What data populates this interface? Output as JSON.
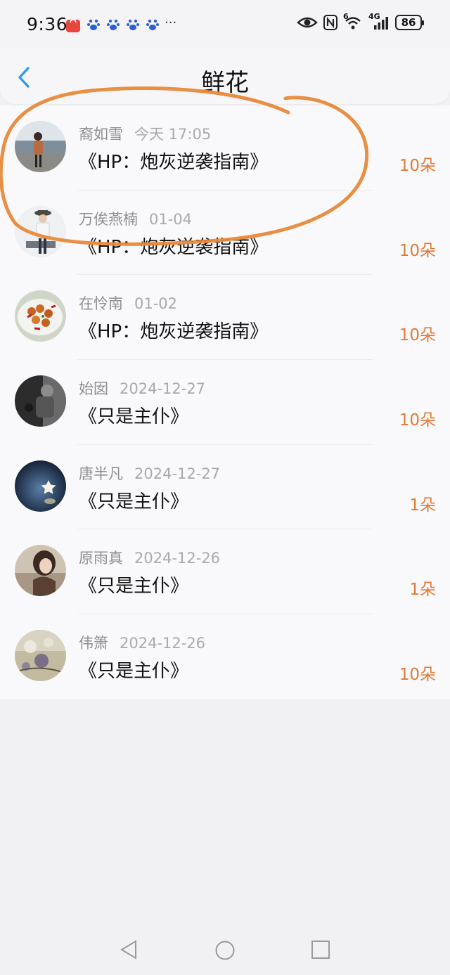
{
  "status_bar": {
    "time": "9:36",
    "more": "···",
    "battery": "86",
    "network": "4G",
    "wifi_badge": "6"
  },
  "header": {
    "title": "鲜花"
  },
  "flowers": [
    {
      "name": "裔如雪",
      "date": "今天 17:05",
      "book": "《HP：炮灰逆袭指南》",
      "count": "10朵"
    },
    {
      "name": "万俟燕楠",
      "date": "01-04",
      "book": "《HP：炮灰逆袭指南》",
      "count": "10朵"
    },
    {
      "name": "在怜南",
      "date": "01-02",
      "book": "《HP：炮灰逆袭指南》",
      "count": "10朵"
    },
    {
      "name": "始囡",
      "date": "2024-12-27",
      "book": "《只是主仆》",
      "count": "10朵"
    },
    {
      "name": "唐半凡",
      "date": "2024-12-27",
      "book": "《只是主仆》",
      "count": "1朵"
    },
    {
      "name": "原雨真",
      "date": "2024-12-26",
      "book": "《只是主仆》",
      "count": "1朵"
    },
    {
      "name": "伟箫",
      "date": "2024-12-26",
      "book": "《只是主仆》",
      "count": "10朵"
    }
  ],
  "colors": {
    "accent": "#e07a37",
    "back_arrow": "#2f9be6",
    "annotation": "#e8893a"
  }
}
